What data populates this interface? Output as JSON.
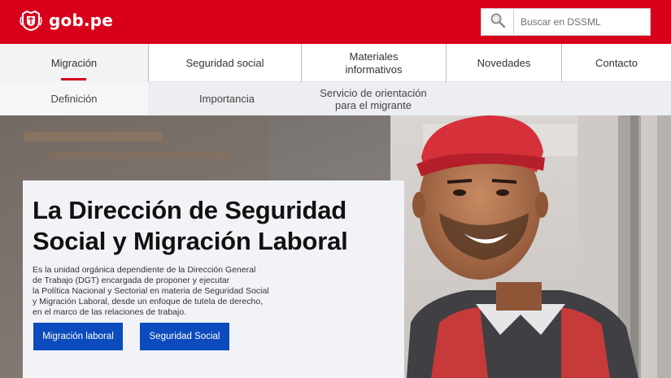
{
  "header": {
    "logo_text": "gob.pe",
    "search_placeholder": "Buscar en DSSML",
    "color": "#d9001b"
  },
  "main_nav": [
    {
      "label": "Migración",
      "active": true
    },
    {
      "label": "Seguridad social"
    },
    {
      "label": "Materiales informativos"
    },
    {
      "label": "Novedades"
    },
    {
      "label": "Contacto"
    }
  ],
  "sub_nav": [
    {
      "label": "Definición"
    },
    {
      "label": "Importancia"
    },
    {
      "label": "Servicio de orientación para el migrante"
    }
  ],
  "hero": {
    "title": "La Dirección de Seguridad Social y Migración Laboral",
    "description": "Es la unidad orgánica dependiente de la Dirección General\nde Trabajo (DGT) encargada de proponer y ejecutar\nla Política Nacional y Sectorial en materia de Seguridad Social\ny Migración Laboral, desde un enfoque de tutela de derecho,\nen el marco de las relaciones de trabajo.",
    "buttons": [
      {
        "label": "Migración laboral"
      },
      {
        "label": "Seguridad Social"
      }
    ],
    "button_color": "#0b4bbd"
  }
}
